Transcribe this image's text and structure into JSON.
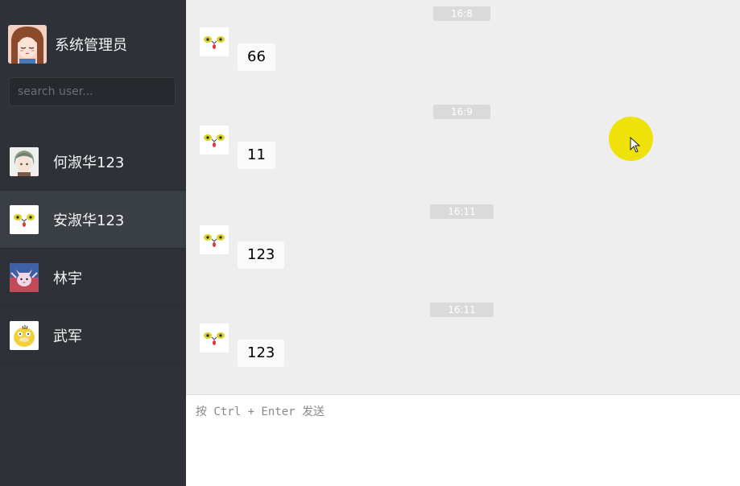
{
  "profile": {
    "name": "系统管理员",
    "avatar_icon": "anime-girl-avatar"
  },
  "search": {
    "placeholder": "search user..."
  },
  "users": [
    {
      "name": "何淑华123",
      "avatar_icon": "anime-boy-avatar",
      "active": false
    },
    {
      "name": "安淑华123",
      "avatar_icon": "frog-face-avatar",
      "active": true
    },
    {
      "name": "林宇",
      "avatar_icon": "cat-avatar",
      "active": false
    },
    {
      "name": "武军",
      "avatar_icon": "psyduck-avatar",
      "active": false
    }
  ],
  "messages": [
    {
      "time": "16:8",
      "text": "66"
    },
    {
      "time": "16:9",
      "text": "11"
    },
    {
      "time": "16:11",
      "text": "123"
    },
    {
      "time": "16:11",
      "text": "123"
    }
  ],
  "composer": {
    "placeholder": "按 Ctrl + Enter 发送"
  },
  "colors": {
    "sidebar_bg": "#2e3238",
    "active_bg": "#3a3f45",
    "panel_bg": "#eeeeee",
    "cursor_highlight": "#efe10a"
  }
}
